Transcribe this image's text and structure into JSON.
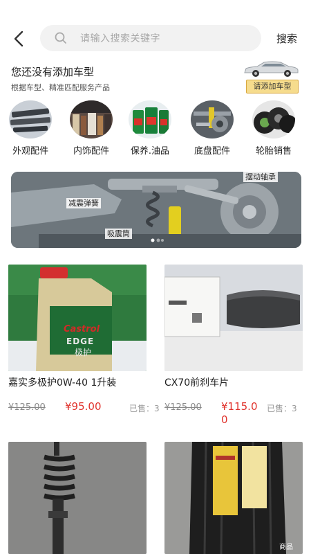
{
  "search": {
    "placeholder": "请输入搜索关键字",
    "button_label": "搜索"
  },
  "vehicle": {
    "title": "您还没有添加车型",
    "subtitle": "根据车型、精准匹配服务产品",
    "add_button": "请添加车型"
  },
  "categories": [
    {
      "label": "外观配件",
      "icon": "exterior-parts-icon"
    },
    {
      "label": "内饰配件",
      "icon": "interior-parts-icon"
    },
    {
      "label": "保养.油品",
      "icon": "oil-maintenance-icon"
    },
    {
      "label": "底盘配件",
      "icon": "chassis-parts-icon"
    },
    {
      "label": "轮胎销售",
      "icon": "tire-icon"
    }
  ],
  "banner": {
    "labels": [
      "摆动轴承",
      "减震弹簧",
      "吸震筒"
    ]
  },
  "products": [
    {
      "name": "嘉实多极护0W-40 1升装",
      "old_price": "¥125.00",
      "price": "¥95.00",
      "sold": "已售：3",
      "image_text_1": "Castrol",
      "image_text_2": "EDGE",
      "image_text_3": "极护"
    },
    {
      "name": "CX70前刹车片",
      "old_price": "¥125.00",
      "price_line1": "¥115.0",
      "price_line2": "0",
      "sold": "已售：3"
    },
    {
      "name": "",
      "image": "shock-absorber"
    },
    {
      "name": "",
      "image": "tire"
    }
  ],
  "footer_tag": "商品"
}
